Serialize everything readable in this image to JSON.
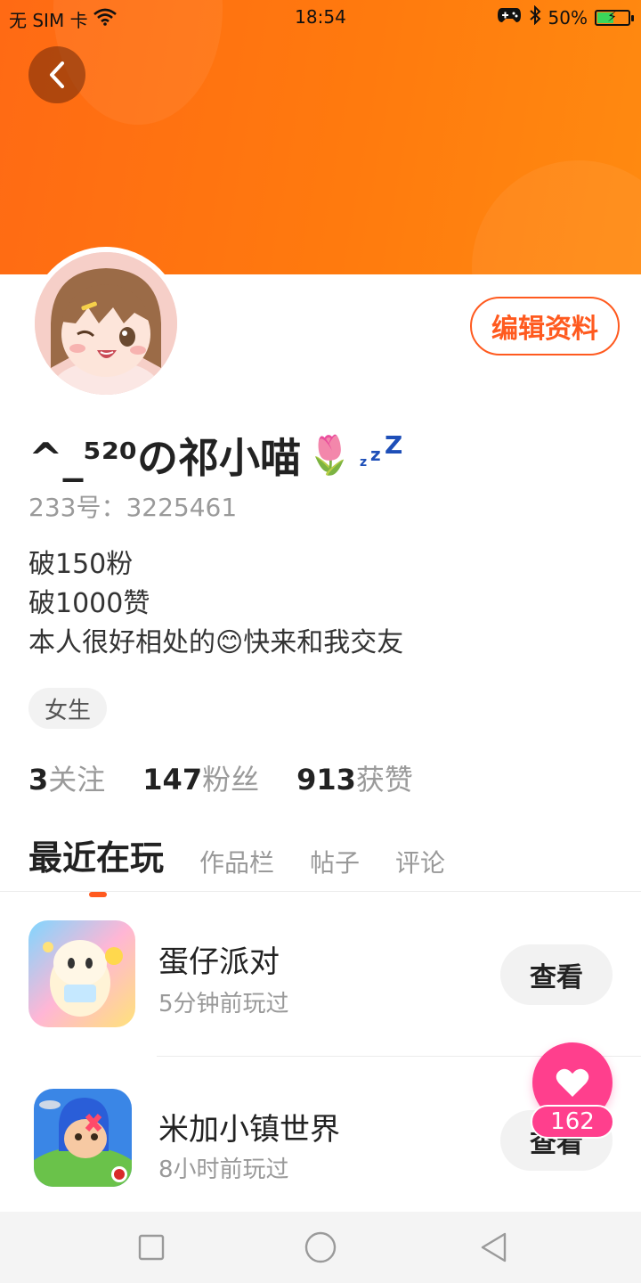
{
  "status_bar": {
    "carrier": "无 SIM 卡",
    "time": "18:54",
    "battery": "50%",
    "battery_level": 0.5
  },
  "profile": {
    "username": "^_⁵²⁰の祁小喵",
    "username_emoji": "🌷",
    "id_text": "233号：3225461",
    "edit_label": "编辑资料",
    "bio": [
      {
        "text": "破150粉"
      },
      {
        "text": "破1000赞"
      },
      {
        "text": "本人很好相处的",
        "emoji": "😊",
        "text_after": "快来和我交友"
      }
    ],
    "tag": "女生"
  },
  "stats": [
    {
      "value": "3",
      "label": "关注"
    },
    {
      "value": "147",
      "label": "粉丝"
    },
    {
      "value": "913",
      "label": "获赞"
    }
  ],
  "tabs": [
    {
      "label": "最近在玩",
      "active": true
    },
    {
      "label": "作品栏",
      "active": false
    },
    {
      "label": "帖子",
      "active": false
    },
    {
      "label": "评论",
      "active": false
    }
  ],
  "games": [
    {
      "name": "蛋仔派对",
      "played": "5分钟前玩过",
      "action": "查看"
    },
    {
      "name": "米加小镇世界",
      "played": "8小时前玩过",
      "action": "查看"
    }
  ],
  "like": {
    "count": "162"
  },
  "colors": {
    "accent": "#ff5a1f",
    "header": "#ff7a0e",
    "like": "#ff3f8d"
  },
  "icons": [
    "back-arrow-icon",
    "wifi-icon",
    "gamepad-icon",
    "bluetooth-icon",
    "battery-icon",
    "heart-icon",
    "nav-square-icon",
    "nav-circle-icon",
    "nav-triangle-icon"
  ]
}
